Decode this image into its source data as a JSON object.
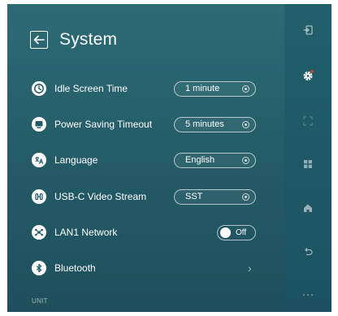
{
  "header": {
    "title": "System"
  },
  "settings": [
    {
      "label": "Idle Screen Time",
      "value": "1 minute",
      "icon": "clock-icon"
    },
    {
      "label": "Power Saving Timeout",
      "value": "5 minutes",
      "icon": "monitor-icon"
    },
    {
      "label": "Language",
      "value": "English",
      "icon": "language-icon"
    },
    {
      "label": "USB-C Video Stream",
      "value": "SST",
      "icon": "usb-c-icon"
    },
    {
      "label": "LAN1 Network",
      "toggle": "Off",
      "icon": "network-icon"
    },
    {
      "label": "Bluetooth",
      "icon": "bluetooth-icon"
    }
  ],
  "footer": {
    "unit_label": "UNIT"
  },
  "rail": {
    "items": [
      "input-icon",
      "settings-gear-icon",
      "scan-icon",
      "apps-grid-icon",
      "home-icon",
      "back-arrow-icon",
      "more-icon"
    ],
    "active": "settings-gear-icon",
    "active_badge_color": "#e0412f"
  },
  "colors": {
    "background": "#235a66",
    "rail": "#1e5664",
    "text": "#ffffff"
  }
}
